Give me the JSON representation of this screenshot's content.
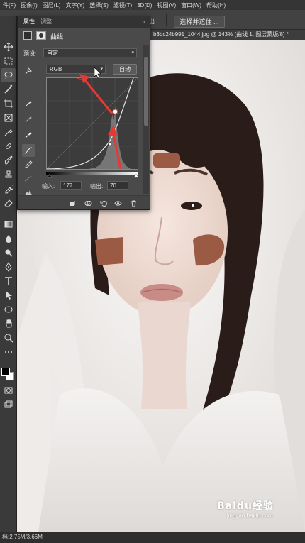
{
  "menubar": {
    "items": [
      "件(F)",
      "图像(I)",
      "图层(L)",
      "文字(Y)",
      "选择(S)",
      "滤镜(T)",
      "3D(D)",
      "视图(V)",
      "窗口(W)",
      "帮助(H)"
    ]
  },
  "optbar": {
    "fragment": "出",
    "select_mask_label": "选择并遮住 ..."
  },
  "doc_tab": {
    "title": "b3bc24b991_1044.jpg @ 143% (曲线 1, 图层蒙版/8) *"
  },
  "properties_panel": {
    "tabs": [
      "属性",
      "调整"
    ],
    "close_glyph": "«",
    "title": "曲线",
    "preset_label": "预设:",
    "preset_value": "自定",
    "channel_value": "RGB",
    "auto_label": "自动",
    "input_label": "输入:",
    "input_value": "177",
    "output_label": "输出:",
    "output_value": "70"
  },
  "status": {
    "doc_size": "档:2.75M/3.66M"
  },
  "watermark": {
    "logo": "Baidu经验",
    "sub": "jingyan.baidu.com"
  },
  "colors": {
    "accent_red": "#e53935",
    "skin_patch": "#9b5a44",
    "panel_bg": "#4a4a4a",
    "ui_dark": "#282828"
  },
  "icons": {
    "toolbar": [
      "move-icon",
      "marquee-icon",
      "lasso-icon",
      "magic-wand-icon",
      "crop-icon",
      "frame-icon",
      "eyedropper-icon",
      "healing-brush-icon",
      "brush-icon",
      "clone-stamp-icon",
      "history-brush-icon",
      "eraser-icon",
      "gradient-icon",
      "blur-icon",
      "dodge-icon",
      "pen-icon",
      "type-icon",
      "path-select-icon",
      "shape-icon",
      "hand-icon",
      "zoom-icon"
    ],
    "footer": [
      "clip-to-layer-icon",
      "view-previous-icon",
      "reset-icon",
      "visibility-eye-icon",
      "trash-icon"
    ]
  },
  "curve": {
    "point_input": 177,
    "point_output": 70
  }
}
